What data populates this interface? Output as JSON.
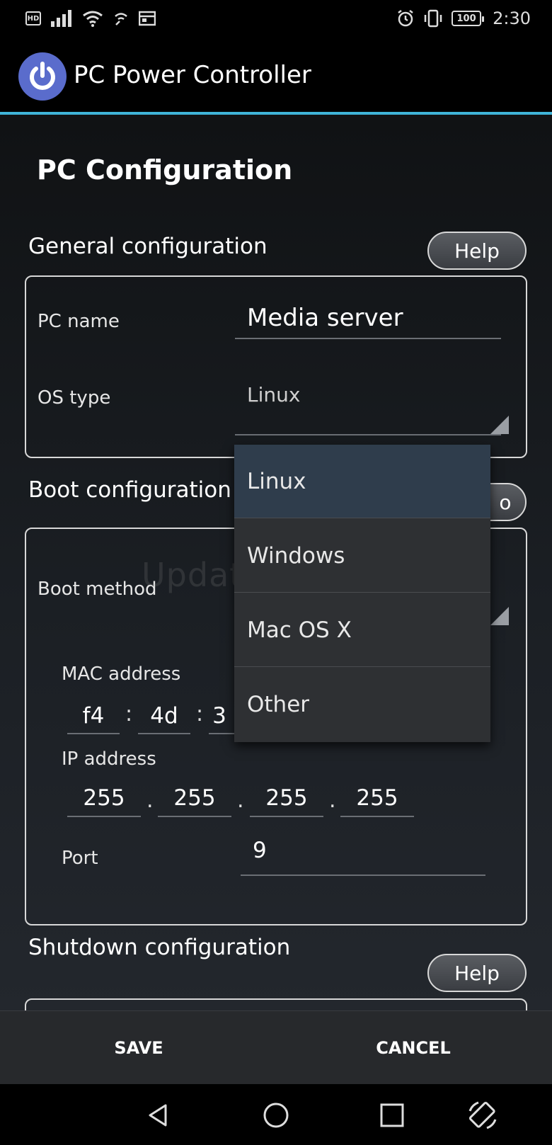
{
  "status_bar": {
    "hd_label": "HD",
    "battery": "100",
    "time": "2:30"
  },
  "app_bar": {
    "title": "PC Power Controller",
    "logo_color": "#5a6ccc",
    "accent": "#3fb4d8"
  },
  "page": {
    "title": "PC Configuration"
  },
  "general": {
    "title": "General configuration",
    "help_label": "Help",
    "pc_name_label": "PC name",
    "pc_name_value": "Media server",
    "os_type_label": "OS type",
    "os_type_value": "Linux"
  },
  "boot": {
    "title": "Boot configuration",
    "help_label_partial": "o",
    "method_label": "Boot method",
    "mac_label": "MAC address",
    "mac": [
      "f4",
      "4d",
      "3"
    ],
    "ip_label": "IP address",
    "ip": [
      "255",
      "255",
      "255",
      "255"
    ],
    "port_label": "Port",
    "port_value": "9"
  },
  "os_dropdown": {
    "options": [
      "Linux",
      "Windows",
      "Mac OS X",
      "Other"
    ],
    "selected": "Linux"
  },
  "shutdown": {
    "title": "Shutdown configuration",
    "help_label": "Help"
  },
  "actions": {
    "save": "SAVE",
    "cancel": "CANCEL"
  },
  "watermark": "UpdateStar.com"
}
